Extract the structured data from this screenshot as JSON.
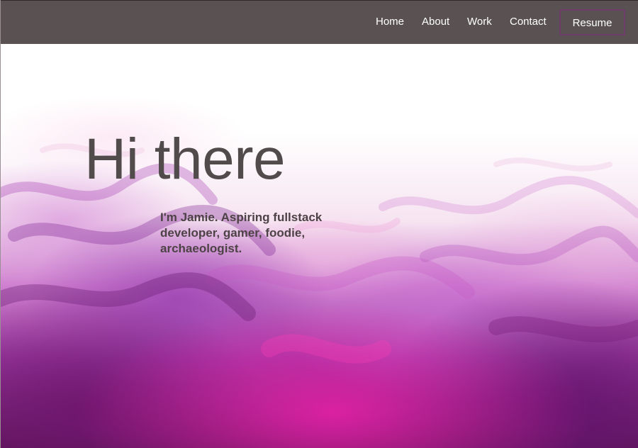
{
  "nav": {
    "links": [
      {
        "label": "Home"
      },
      {
        "label": "About"
      },
      {
        "label": "Work"
      },
      {
        "label": "Contact"
      }
    ],
    "resume_label": "Resume"
  },
  "hero": {
    "title": "Hi there",
    "subtitle": "I'm Jamie. Aspiring fullstack developer, gamer, foodie, archaeologist."
  },
  "colors": {
    "navbar_bg": "#5a5252",
    "resume_border": "#6e3d6a",
    "heading_text": "#524b4c",
    "subtitle_text": "#4d4245",
    "smoke_pink": "#ec20aa",
    "smoke_purple": "#5c1656"
  }
}
